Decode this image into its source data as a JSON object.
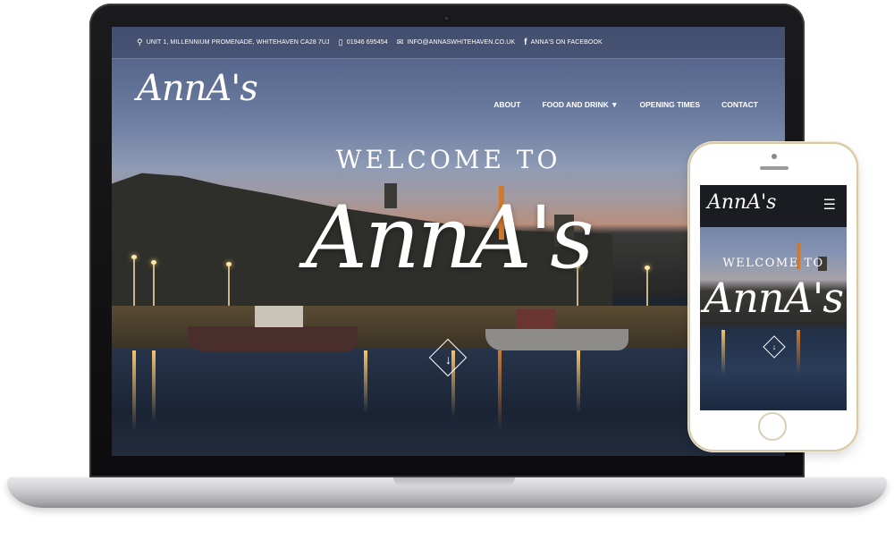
{
  "site": {
    "topbar": {
      "address": "UNIT 1, MILLENNIUM PROMENADE, WHITEHAVEN CA28 7UJ",
      "phone": "01946 695454",
      "email": "INFO@ANNASWHITEHAVEN.CO.UK",
      "facebook": "ANNA'S ON FACEBOOK"
    },
    "icons": {
      "address": "location-pin-icon",
      "phone": "mobile-phone-icon",
      "email": "envelope-icon",
      "facebook": "facebook-icon",
      "scroll": "arrow-down-icon",
      "menu": "hamburger-menu-icon"
    },
    "logo": "AnnA's",
    "nav": [
      {
        "label": "ABOUT"
      },
      {
        "label": "FOOD AND DRINK ▼"
      },
      {
        "label": "OPENING TIMES"
      },
      {
        "label": "CONTACT"
      }
    ],
    "hero": {
      "welcome": "WELCOME TO",
      "title": "AnnA's",
      "scroll_glyph": "↓"
    }
  },
  "mobile": {
    "logo": "AnnA's",
    "menu_glyph": "☰",
    "welcome": "WELCOME TO",
    "title": "AnnA's",
    "scroll_glyph": "↓"
  },
  "colors": {
    "bezel": "#111113",
    "phone_gold": "#d8c9a7",
    "text": "#ffffff"
  }
}
